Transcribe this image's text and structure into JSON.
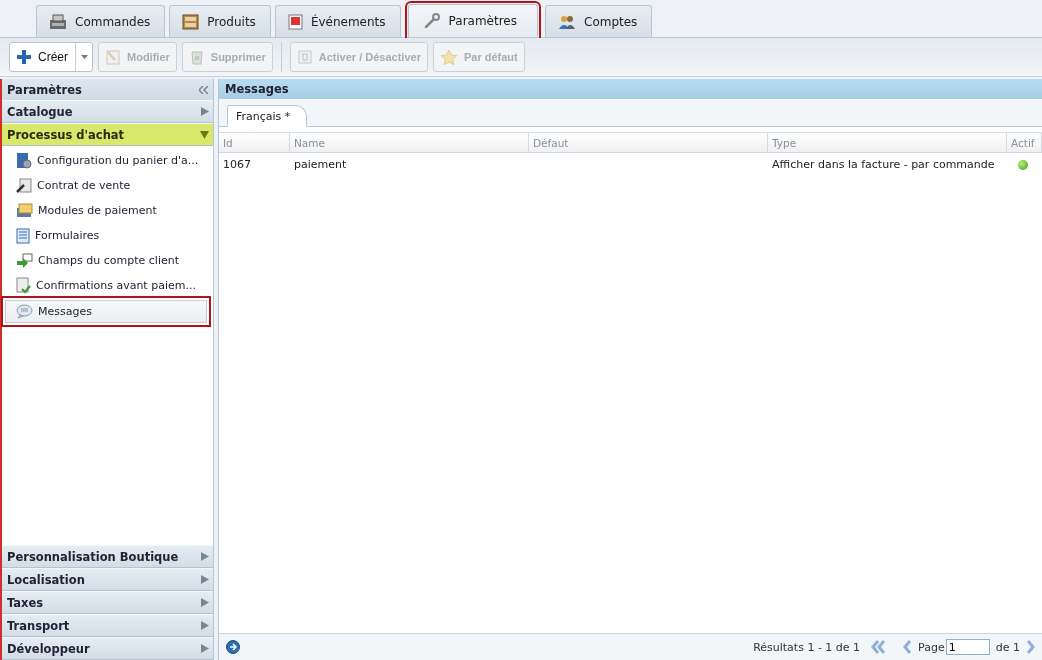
{
  "tabs": [
    {
      "label": "Commandes",
      "selected": false
    },
    {
      "label": "Produits",
      "selected": false
    },
    {
      "label": "Événements",
      "selected": false
    },
    {
      "label": "Paramètres",
      "selected": true
    },
    {
      "label": "Comptes",
      "selected": false
    }
  ],
  "toolbar": [
    {
      "kind": "split",
      "label": "Créer",
      "disabled": false
    },
    {
      "kind": "button",
      "label": "Modifier",
      "disabled": true
    },
    {
      "kind": "button",
      "label": "Supprimer",
      "disabled": true
    },
    {
      "kind": "separator"
    },
    {
      "kind": "button",
      "label": "Activer / Désactiver",
      "disabled": true
    },
    {
      "kind": "button",
      "label": "Par défaut",
      "disabled": true
    }
  ],
  "sidebar": {
    "title": "Paramètres",
    "sections": [
      {
        "label": "Catalogue",
        "expanded": false,
        "selected": false
      },
      {
        "label": "Processus d'achat",
        "expanded": true,
        "selected": true,
        "items": [
          {
            "label": "Configuration du panier d'a...",
            "selected": false
          },
          {
            "label": "Contrat de vente",
            "selected": false
          },
          {
            "label": "Modules de paiement",
            "selected": false
          },
          {
            "label": "Formulaires",
            "selected": false
          },
          {
            "label": "Champs du compte client",
            "selected": false
          },
          {
            "label": "Confirmations avant paiem...",
            "selected": false
          },
          {
            "label": "Messages",
            "selected": true
          }
        ]
      },
      {
        "label": "Personnalisation Boutique",
        "expanded": false,
        "selected": false
      },
      {
        "label": "Localisation",
        "expanded": false,
        "selected": false
      },
      {
        "label": "Taxes",
        "expanded": false,
        "selected": false
      },
      {
        "label": "Transport",
        "expanded": false,
        "selected": false
      },
      {
        "label": "Développeur",
        "expanded": false,
        "selected": false
      }
    ]
  },
  "main": {
    "title": "Messages",
    "language_tabs": [
      {
        "label": "Français *",
        "selected": true
      }
    ],
    "table": {
      "columns": [
        "Id",
        "Name",
        "Défaut",
        "Type",
        "Actif"
      ],
      "rows": [
        {
          "id": "1067",
          "name": "paiement",
          "default": "",
          "type": "Afficher dans la facture - par commande",
          "active": true
        }
      ]
    },
    "pager": {
      "summary": "Résultats 1 - 1 de 1",
      "page_label": "Page",
      "page": "1",
      "of": "de 1"
    }
  }
}
